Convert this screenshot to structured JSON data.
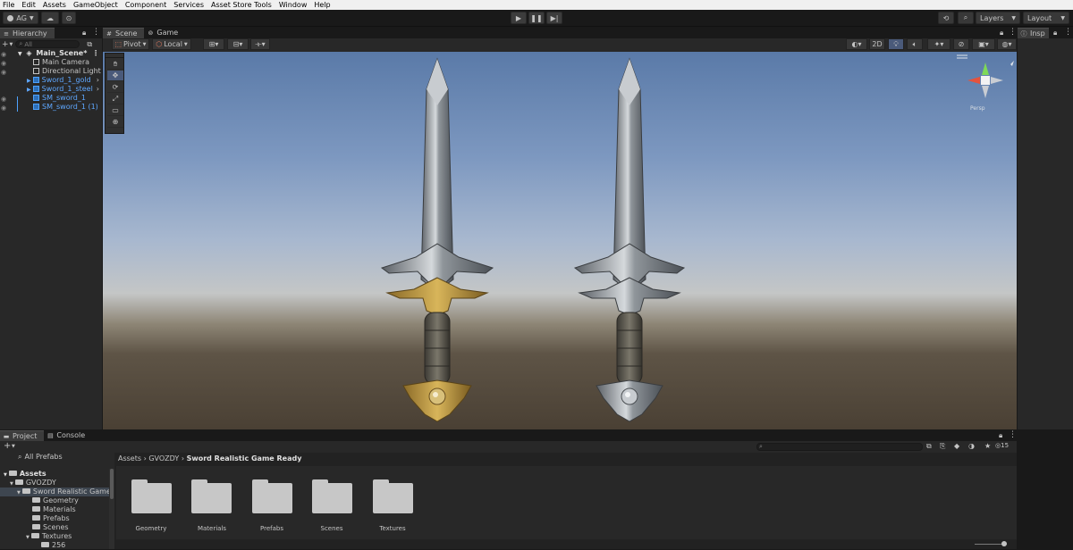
{
  "menubar": {
    "items": [
      "File",
      "Edit",
      "Assets",
      "GameObject",
      "Component",
      "Services",
      "Asset Store Tools",
      "Window",
      "Help"
    ]
  },
  "toolbar": {
    "account_label": "AG",
    "layers_label": "Layers",
    "layout_label": "Layout"
  },
  "hierarchy": {
    "tab_label": "Hierarchy",
    "search_placeholder": "All",
    "scene_name": "Main_Scene*",
    "items": [
      {
        "label": "Main Camera",
        "prefab": false
      },
      {
        "label": "Directional Light",
        "prefab": false
      },
      {
        "label": "Sword_1_gold",
        "prefab": true
      },
      {
        "label": "Sword_1_steel",
        "prefab": true
      },
      {
        "label": "SM_sword_1",
        "prefab": true
      },
      {
        "label": "SM_sword_1 (1)",
        "prefab": true
      }
    ]
  },
  "scene": {
    "tabs": [
      {
        "label": "Scene"
      },
      {
        "label": "Game"
      }
    ],
    "pivot_label": "Pivot",
    "local_label": "Local",
    "mode_2d_label": "2D",
    "gizmo_persp_label": "Persp"
  },
  "inspector": {
    "tab_label": "Insp"
  },
  "project": {
    "tabs": [
      {
        "label": "Project"
      },
      {
        "label": "Console"
      }
    ],
    "favorites_label": "All Prefabs",
    "tree": [
      {
        "label": "Assets"
      },
      {
        "label": "GVOZDY"
      },
      {
        "label": "Sword Realistic Game R"
      },
      {
        "label": "Geometry"
      },
      {
        "label": "Materials"
      },
      {
        "label": "Prefabs"
      },
      {
        "label": "Scenes"
      },
      {
        "label": "Textures"
      },
      {
        "label": "256"
      }
    ],
    "breadcrumb": [
      "Assets",
      "GVOZDY",
      "Sword Realistic Game Ready"
    ],
    "hidden_count": "15",
    "folders": [
      {
        "label": "Geometry"
      },
      {
        "label": "Materials"
      },
      {
        "label": "Prefabs"
      },
      {
        "label": "Scenes"
      },
      {
        "label": "Textures"
      }
    ]
  },
  "colors": {
    "accent": "#4ea2ff",
    "panel": "#282828",
    "gold": "#c4a048",
    "steel": "#a8aeb4"
  }
}
